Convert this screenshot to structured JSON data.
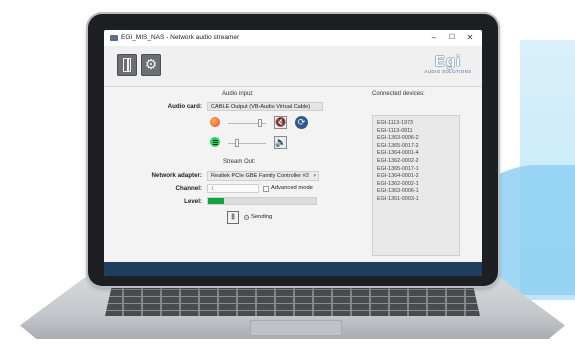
{
  "window": {
    "title": "EGI_MIS_NAS - Network audio streamer",
    "controls": {
      "minimize": "–",
      "maximize": "☐",
      "close": "✕"
    }
  },
  "toolbar": {
    "buttons": [
      {
        "name": "exit",
        "icon": "door-icon"
      },
      {
        "name": "settings",
        "icon": "gear-icon"
      }
    ]
  },
  "logo": {
    "mark": "Egi",
    "sub": "AUDIO SOLUTIONS"
  },
  "audio_input": {
    "heading": "Audio input:",
    "audio_card_label": "Audio card:",
    "audio_card_value": "CABLE Output (VB-Audio Virtual Cable)",
    "apps": [
      {
        "name": "Firefox",
        "icon": "firefox-icon",
        "volume": 0.8,
        "muted": true
      },
      {
        "name": "Spotify",
        "icon": "spotify-icon",
        "volume": 0.2,
        "muted": false
      }
    ]
  },
  "stream_out": {
    "heading": "Stream Out:",
    "network_adapter_label": "Network adapter:",
    "network_adapter_value": "Realtek PCIe GBE Family Controller #2",
    "channel_label": "Channel:",
    "channel_value": "1",
    "advanced_mode_label": "Advanced mode",
    "advanced_mode_checked": false,
    "level_label": "Level:",
    "level": 0.15,
    "status_text": "Sending"
  },
  "connected_devices": {
    "heading": "Connected devices:",
    "items": [
      "EGI-1113-1973",
      "EGI-1113-0811",
      "EGI-1363-0006-2",
      "EGI-1365-0017-2",
      "EGI-1364-0001-4",
      "EGI-1362-0002-2",
      "EGI-1365-0017-1",
      "EGI-1364-0001-2",
      "EGI-1362-0002-1",
      "EGI-1363-0006-1",
      "EGI-1361-0003-1"
    ]
  },
  "colors": {
    "accent": "#2e5a8c",
    "level_fill": "#13a440",
    "taskbar": "#1f3e5b"
  }
}
